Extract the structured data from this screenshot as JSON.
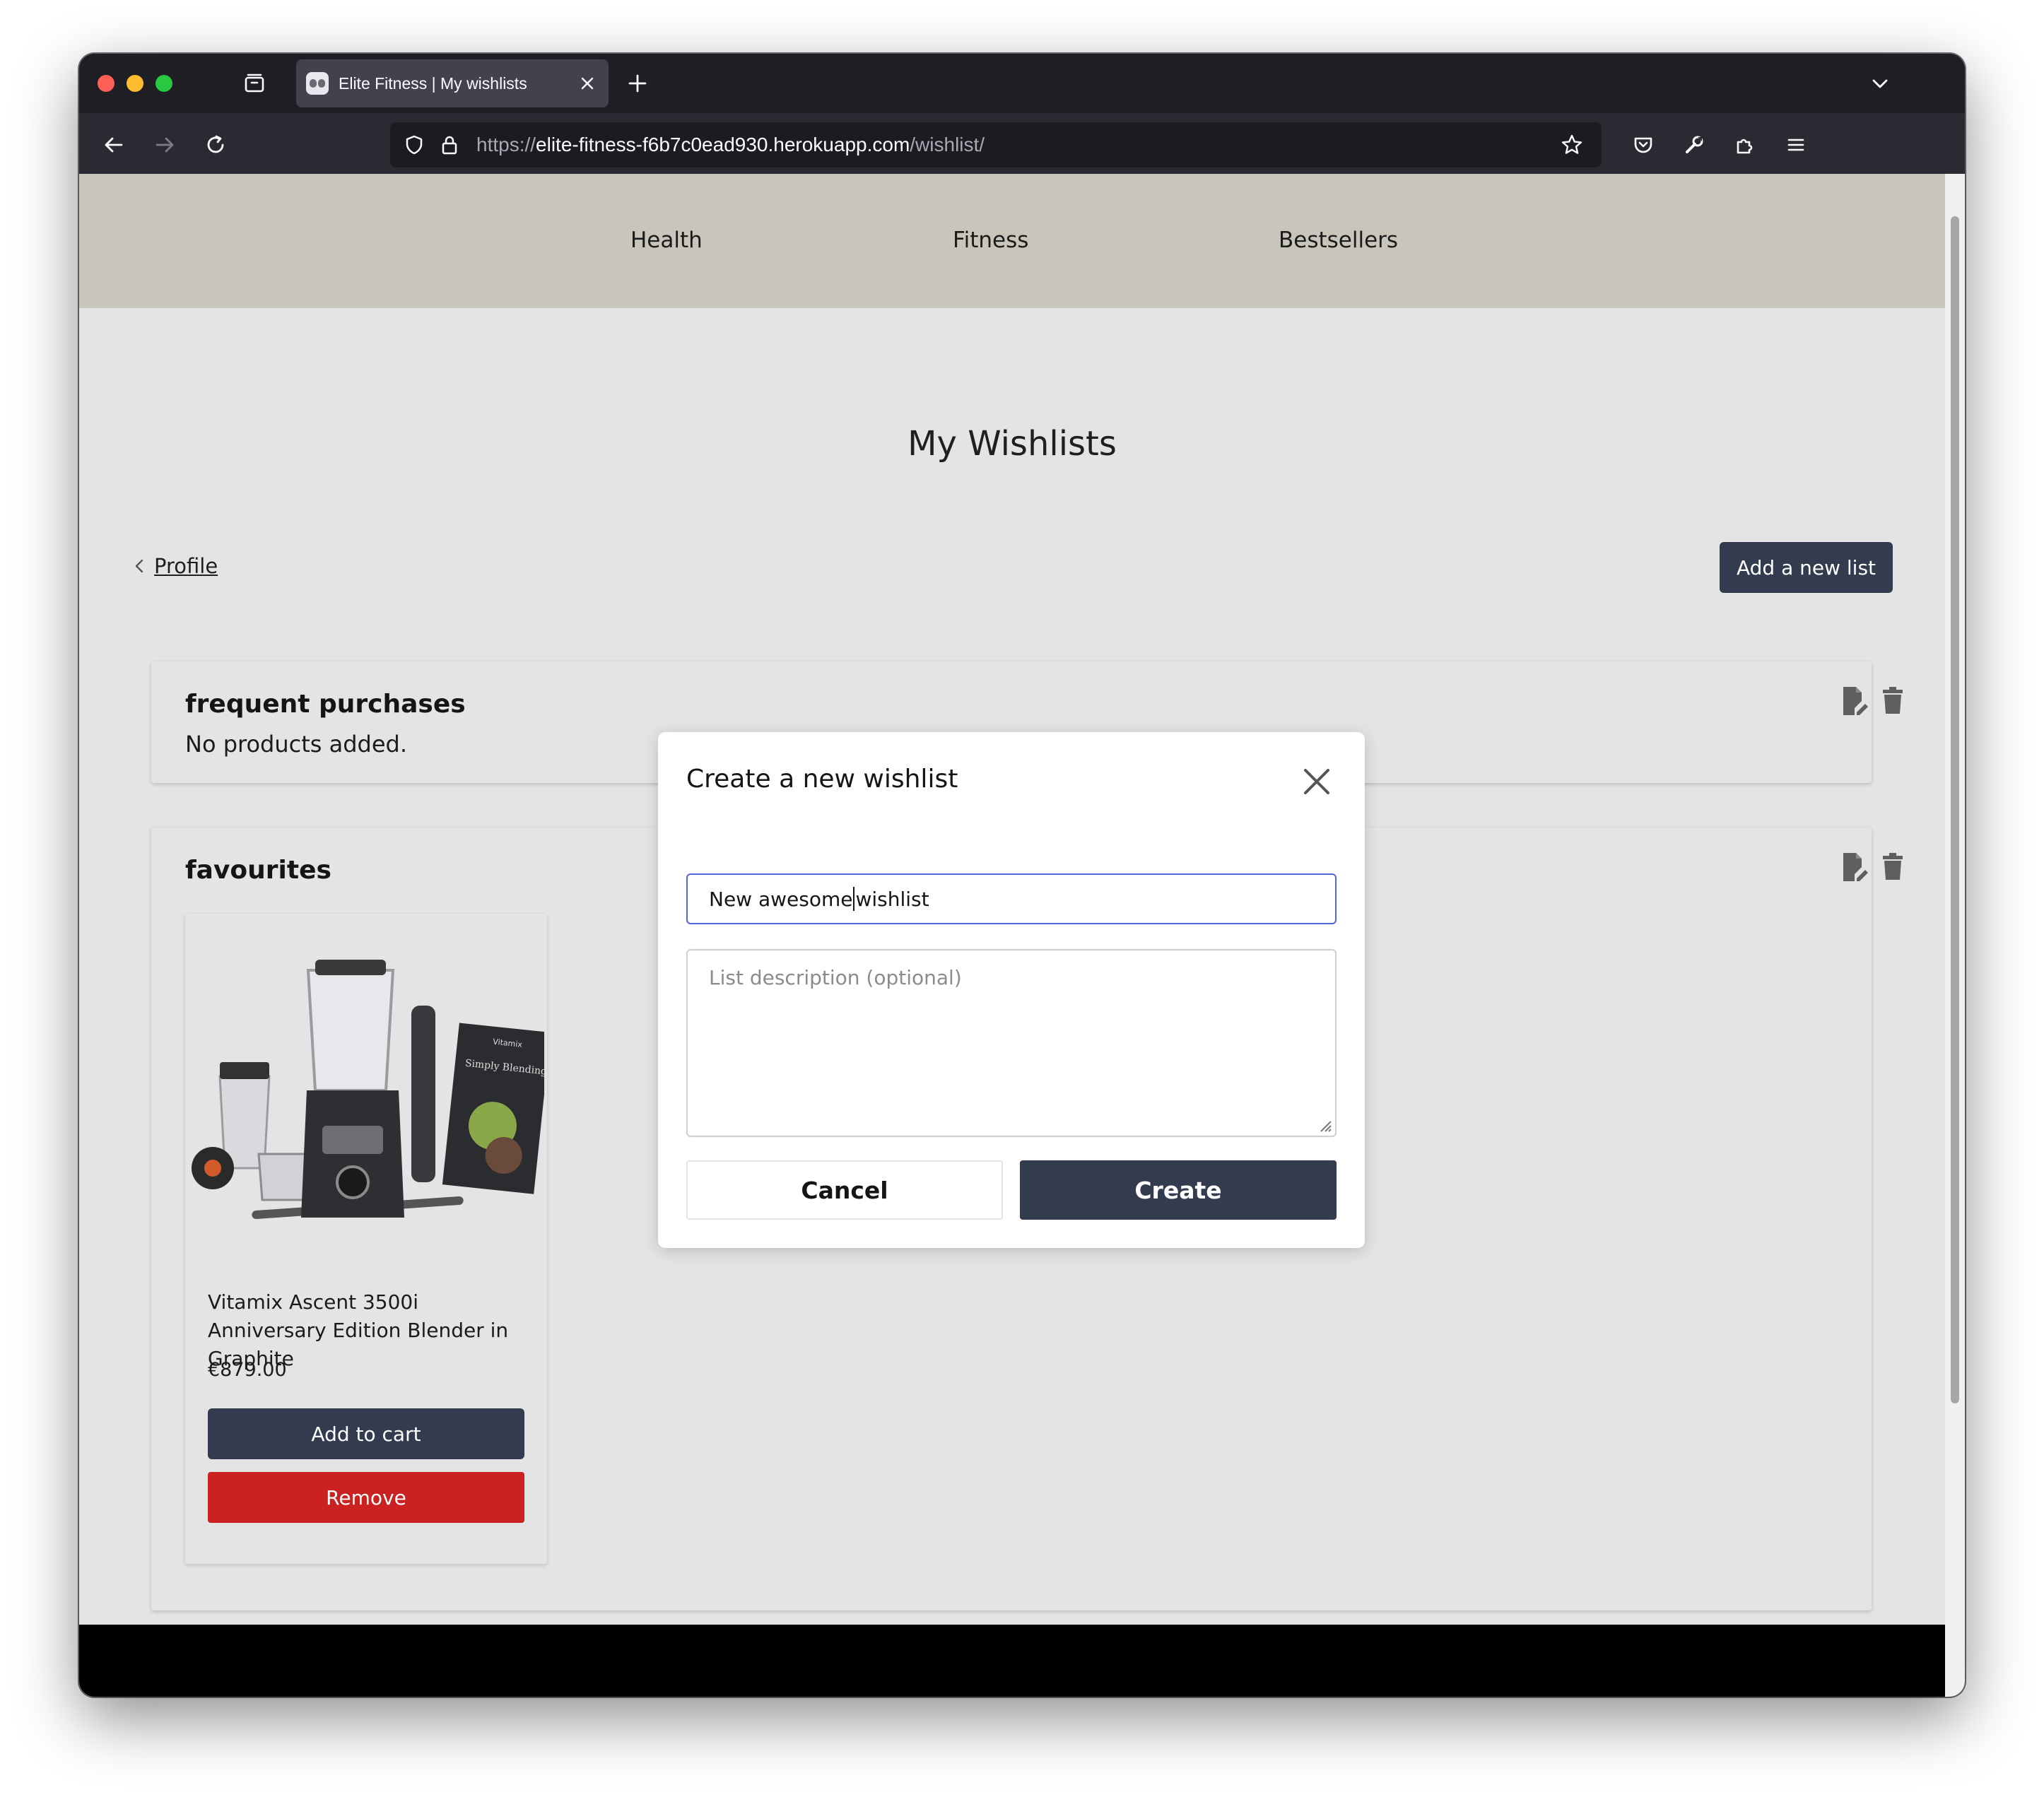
{
  "browser": {
    "tab_title": "Elite Fitness | My wishlists",
    "url_scheme": "https://",
    "url_host": "elite-fitness-f6b7c0ead930.herokuapp.com",
    "url_path": "/wishlist/"
  },
  "nav": {
    "items": [
      "Health",
      "Fitness",
      "Bestsellers"
    ]
  },
  "page": {
    "title": "My Wishlists",
    "back_label": "Profile",
    "add_list_label": "Add a new list"
  },
  "wishlists": [
    {
      "name": "frequent purchases",
      "empty_text": "No products added."
    },
    {
      "name": "favourites"
    }
  ],
  "product": {
    "name": "Vitamix Ascent 3500i Anniversary Edition Blender in Graphite",
    "price": "€879.00",
    "add_to_cart_label": "Add to cart",
    "remove_label": "Remove",
    "book_title": "Simply Blending",
    "book_brand": "Vitamix"
  },
  "modal": {
    "title": "Create a new wishlist",
    "name_value_before_caret": "New awesome",
    "name_value_after_caret": "wishlist",
    "description_placeholder": "List description (optional)",
    "cancel_label": "Cancel",
    "create_label": "Create"
  },
  "colors": {
    "header_bg": "#c8c6bb",
    "page_bg": "#e4e4e4",
    "primary_button": "#323c4e",
    "danger_button": "#cc2121",
    "focus_border": "#5865d6"
  }
}
